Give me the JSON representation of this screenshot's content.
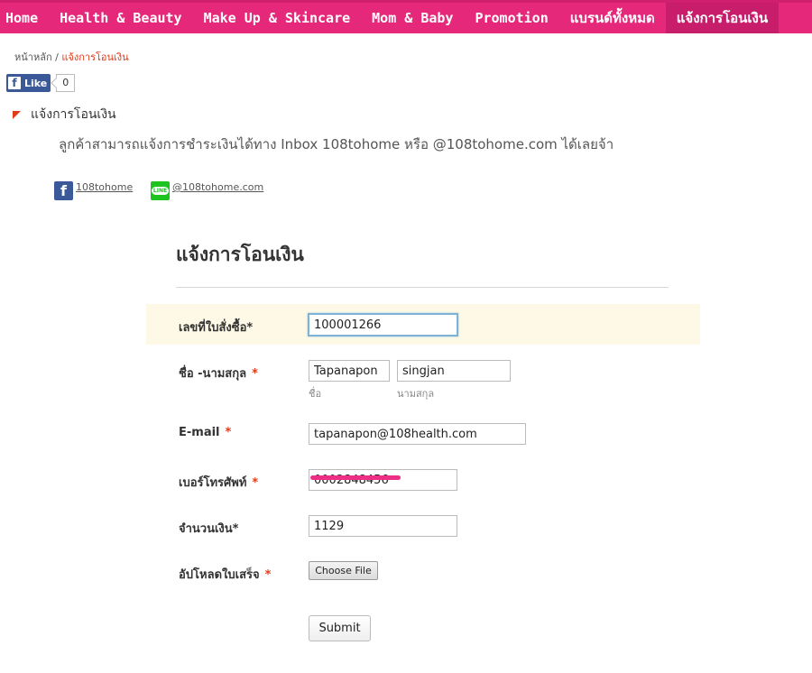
{
  "nav": {
    "items": [
      "Home",
      "Health & Beauty",
      "Make Up & Skincare",
      "Mom & Baby",
      "Promotion",
      "แบรนด์ทั้งหมด",
      "แจ้งการโอนเงิน"
    ],
    "accent": "#e5287a",
    "active_bg": "#c81d6a"
  },
  "breadcrumb": {
    "home": "หน้าหลัก",
    "sep": "/",
    "current": "แจ้งการโอนเงิน"
  },
  "fb": {
    "like_label": "Like",
    "count": "0"
  },
  "section": {
    "title": "แจ้งการโอนเงิน"
  },
  "intro": "ลูกค้าสามารถแจ้งการชำระเงินได้ทาง Inbox 108tohome หรือ @108tohome.com ได้เลยจ้า",
  "social": {
    "facebook_label": "108tohome",
    "line_label": "@108tohome.com"
  },
  "form": {
    "title": "แจ้งการโอนเงิน",
    "order_label": "เลขที่ใบสั่งซื้อ*",
    "order_value": "100001266",
    "name_label": "ชื่อ -นามสกุล",
    "req_mark": "*",
    "first_name": "Tapanapon",
    "last_name": "singjan",
    "first_name_sub": "ชื่อ",
    "last_name_sub": "นามสกุล",
    "email_label": "E-mail",
    "email_value": "tapanapon@108health.com",
    "phone_label": "เบอร์โทรศัพท์",
    "phone_value": "0002848456",
    "amount_label": "จำนวนเงิน*",
    "amount_value": "1129",
    "upload_label": "อัปโหลดใบเสร็จ",
    "choose_file": "Choose File",
    "submit": "Submit"
  }
}
